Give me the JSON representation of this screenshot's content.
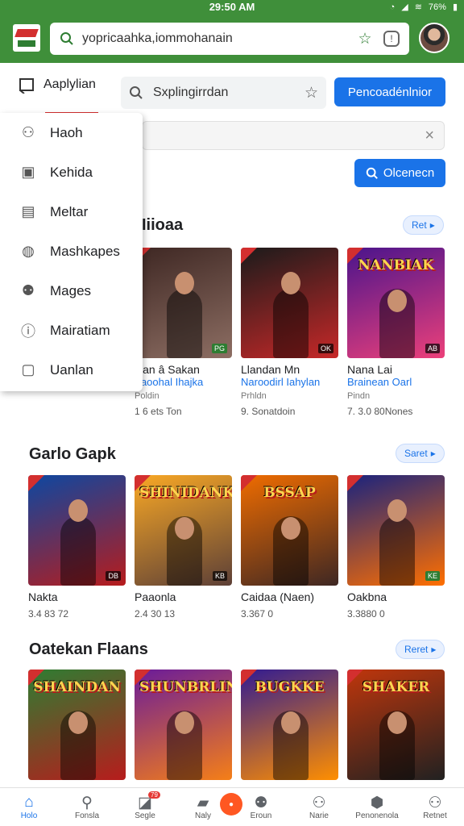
{
  "status_bar": {
    "time": "29:50 AM",
    "battery": "76%"
  },
  "top_bar": {
    "url": "yopricaahka,iommohanain"
  },
  "nav": {
    "tab_label": "Aaplylian",
    "search_placeholder": "Sxplingirrdan",
    "primary_button": "Pencoadénlnior"
  },
  "search_button": "Olcenecn",
  "dropdown": {
    "items": [
      {
        "label": "Haoh",
        "icon": "person-icon"
      },
      {
        "label": "Kehida",
        "icon": "image-icon"
      },
      {
        "label": "Meltar",
        "icon": "document-icon"
      },
      {
        "label": "Mashkapes",
        "icon": "compass-icon"
      },
      {
        "label": "Mages",
        "icon": "group-icon"
      },
      {
        "label": "Mairatiam",
        "icon": "info-icon"
      },
      {
        "label": "Uanlan",
        "icon": "chat-icon"
      }
    ]
  },
  "sections": [
    {
      "title": "Iiioaa",
      "more": "Ret",
      "cards": [
        {
          "title": "Ran â Sakan",
          "sub": "Faoohal Ihajka",
          "meta": "Poldin",
          "stat": "1 6 ets Ton",
          "badge": "PG",
          "colors": [
            "#3e2723",
            "#8d6e63"
          ],
          "logo": ""
        },
        {
          "title": "Llandan Mn",
          "sub": "Naroodirl Iahylan",
          "meta": "Prhldn",
          "stat": "9. Sonatdoin",
          "badge": "OK",
          "colors": [
            "#1b1b1b",
            "#c62828"
          ],
          "logo": ""
        },
        {
          "title": "Nana Lai",
          "sub": "Brainean Oarl",
          "meta": "Pindn",
          "stat": "7. 3.0 80Nones",
          "badge": "AB",
          "colors": [
            "#4a148c",
            "#ec407a"
          ],
          "logo": "NANBIAK"
        }
      ]
    },
    {
      "title": "Garlo Gapk",
      "more": "Saret",
      "cards": [
        {
          "title": "Nakta",
          "stat": "3.4 83 72",
          "badge": "DB",
          "colors": [
            "#0d47a1",
            "#b71c1c"
          ],
          "logo": ""
        },
        {
          "title": "Paaonla",
          "stat": "2.4 30 13",
          "badge": "KB",
          "colors": [
            "#f9a825",
            "#5d4037"
          ],
          "logo": "SHINIDANK"
        },
        {
          "title": "Caidaa (Naen)",
          "stat": "3.367 0",
          "badge": "",
          "colors": [
            "#ef6c00",
            "#3e2723"
          ],
          "logo": "BSSAP"
        },
        {
          "title": "Oakbna",
          "stat": "3.3880 0",
          "badge": "KE",
          "colors": [
            "#1a237e",
            "#ff6f00"
          ],
          "logo": ""
        }
      ]
    },
    {
      "title": "Oatekan Flaans",
      "more": "Reret",
      "cards": [
        {
          "title": "",
          "colors": [
            "#2e7d32",
            "#b71c1c"
          ],
          "logo": "SHAINDAN"
        },
        {
          "title": "",
          "colors": [
            "#6a1b9a",
            "#f57f17"
          ],
          "logo": "SHUNBRLINS"
        },
        {
          "title": "",
          "colors": [
            "#311b92",
            "#ff8f00"
          ],
          "logo": "BUGKKE"
        },
        {
          "title": "",
          "colors": [
            "#bf360c",
            "#212121"
          ],
          "logo": "SHAKER"
        }
      ]
    }
  ],
  "bottom_nav": [
    {
      "label": "Holo",
      "icon": "home-icon",
      "active": true
    },
    {
      "label": "Fonsla",
      "icon": "search-icon"
    },
    {
      "label": "Segle",
      "icon": "games-icon",
      "badge": "79"
    },
    {
      "label": "Naly",
      "icon": "movies-icon"
    },
    {
      "label": "Eroun",
      "icon": "apps-icon"
    },
    {
      "label": "Narie",
      "icon": "person-icon"
    },
    {
      "label": "Penonenola",
      "icon": "shield-icon"
    },
    {
      "label": "Retnet",
      "icon": "account-icon"
    }
  ]
}
